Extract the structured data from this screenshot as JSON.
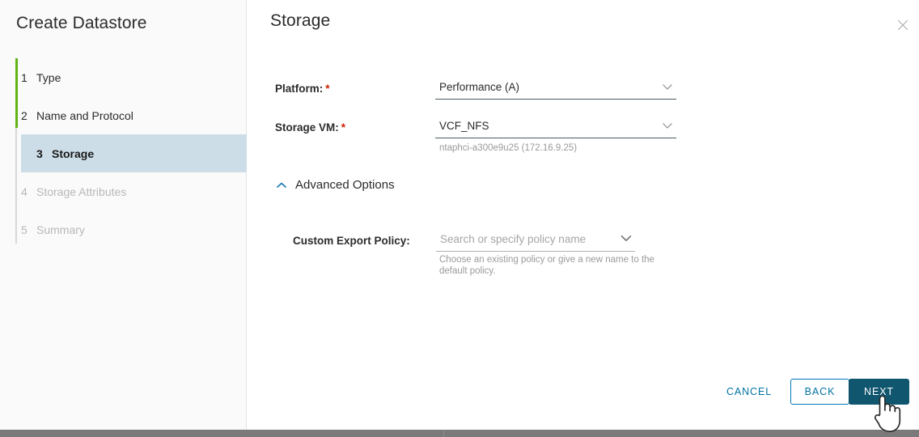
{
  "wizard": {
    "title": "Create Datastore",
    "steps": [
      {
        "num": "1",
        "label": "Type",
        "state": "complete"
      },
      {
        "num": "2",
        "label": "Name and Protocol",
        "state": "complete"
      },
      {
        "num": "3",
        "label": "Storage",
        "state": "current"
      },
      {
        "num": "4",
        "label": "Storage Attributes",
        "state": "disabled"
      },
      {
        "num": "5",
        "label": "Summary",
        "state": "disabled"
      }
    ]
  },
  "panel": {
    "title": "Storage",
    "close_icon": "close-icon"
  },
  "form": {
    "platform": {
      "label": "Platform:",
      "required_marker": "*",
      "value": "Performance (A)",
      "chevron_icon": "chevron-down-icon"
    },
    "storage_vm": {
      "label": "Storage VM:",
      "required_marker": "*",
      "value": "VCF_NFS",
      "hint": "ntaphci-a300e9u25 (172.16.9.25)",
      "chevron_icon": "chevron-down-icon"
    },
    "advanced_options": {
      "label": "Advanced Options",
      "expanded": true,
      "chevron_icon": "chevron-up-icon"
    },
    "custom_export_policy": {
      "label": "Custom Export Policy:",
      "value": "",
      "placeholder": "Search or specify policy name",
      "hint": "Choose an existing policy or give a new name to the default policy.",
      "chevron_icon": "chevron-down-icon"
    }
  },
  "footer": {
    "cancel_label": "CANCEL",
    "back_label": "BACK",
    "next_label": "NEXT"
  },
  "colors": {
    "accent_green": "#60b515",
    "primary_button": "#10566e",
    "link_blue": "#0072a3",
    "required_red": "#c92100",
    "current_step_bg": "#ccdde7"
  },
  "cursor": {
    "icon": "pointing-hand-cursor"
  }
}
